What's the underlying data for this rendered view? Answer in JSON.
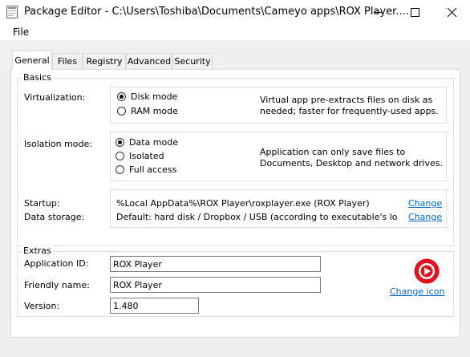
{
  "window": {
    "title": "Package Editor - C:\\Users\\Toshiba\\Documents\\Cameyo apps\\ROX Player...."
  },
  "menu": {
    "items": [
      "File"
    ]
  },
  "tabs": [
    {
      "label": "General",
      "active": true
    },
    {
      "label": "Files"
    },
    {
      "label": "Registry"
    },
    {
      "label": "Advanced"
    },
    {
      "label": "Security"
    }
  ],
  "basics": {
    "legend": "Basics",
    "virtualization": {
      "label": "Virtualization:",
      "options": [
        "Disk mode",
        "RAM mode"
      ],
      "selected": "Disk mode",
      "description": [
        "Virtual app pre-extracts files on disk as",
        "needed; faster for frequently-used apps."
      ]
    },
    "isolation": {
      "label": "Isolation mode:",
      "options": [
        "Data mode",
        "Isolated",
        "Full access"
      ],
      "selected": "Data mode",
      "description": [
        "Application can only save files to",
        "Documents, Desktop and network drives."
      ]
    },
    "startup": {
      "label": "Startup:",
      "value": "%Local AppData%\\ROX Player\\roxplayer.exe (ROX Player)",
      "change": "Change"
    },
    "data_storage": {
      "label": "Data storage:",
      "value": "Default: hard disk / Dropbox / USB (according to executable's lo",
      "change": "Change"
    }
  },
  "extras": {
    "legend": "Extras",
    "app_id": {
      "label": "Application ID:",
      "value": "ROX Player"
    },
    "friendly_name": {
      "label": "Friendly name:",
      "value": "ROX Player"
    },
    "version": {
      "label": "Version:",
      "value": "1.480"
    },
    "change_icon": "Change icon",
    "icon": "rox-player-icon",
    "icon_color": "#e0141e"
  }
}
